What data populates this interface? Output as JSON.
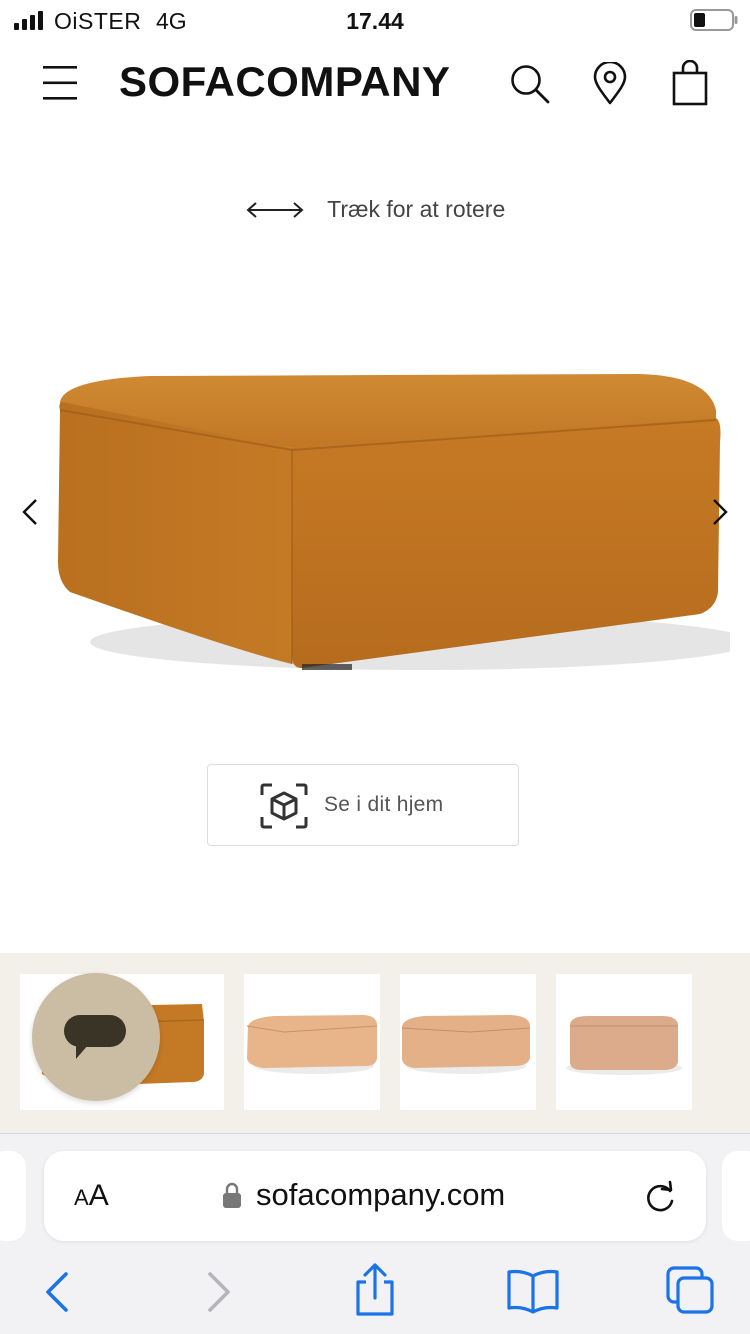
{
  "status_bar": {
    "carrier": "OiSTER",
    "network": "4G",
    "time": "17.44",
    "icons": [
      "signal-bars-icon",
      "battery-icon"
    ]
  },
  "nav": {
    "logo": "SOFACOMPANY",
    "icons": [
      "hamburger-menu-icon",
      "search-icon",
      "location-pin-icon",
      "shopping-bag-icon"
    ]
  },
  "product_viewer": {
    "rotate_hint": "Træk for at rotere",
    "product_color": "#c47a25",
    "prev_icon": "chevron-left-icon",
    "next_icon": "chevron-right-icon",
    "ar_button_label": "Se i dit hjem",
    "ar_icon": "ar-cube-icon"
  },
  "thumbnails": {
    "items": [
      {
        "color": "#c47a25",
        "selected": true
      },
      {
        "color": "#e8b48a",
        "selected": false
      },
      {
        "color": "#e3b088",
        "selected": false
      },
      {
        "color": "#dcab8c",
        "selected": false
      }
    ],
    "chat_icon": "chat-bubble-icon",
    "chat_color": "#cbbca4"
  },
  "browser": {
    "aa_label": "AA",
    "url": "sofacompany.com",
    "accent": "#1a73e8",
    "toolbar_icons": [
      "back-arrow-icon",
      "forward-arrow-icon",
      "share-icon",
      "bookmarks-icon",
      "tabs-icon"
    ]
  }
}
